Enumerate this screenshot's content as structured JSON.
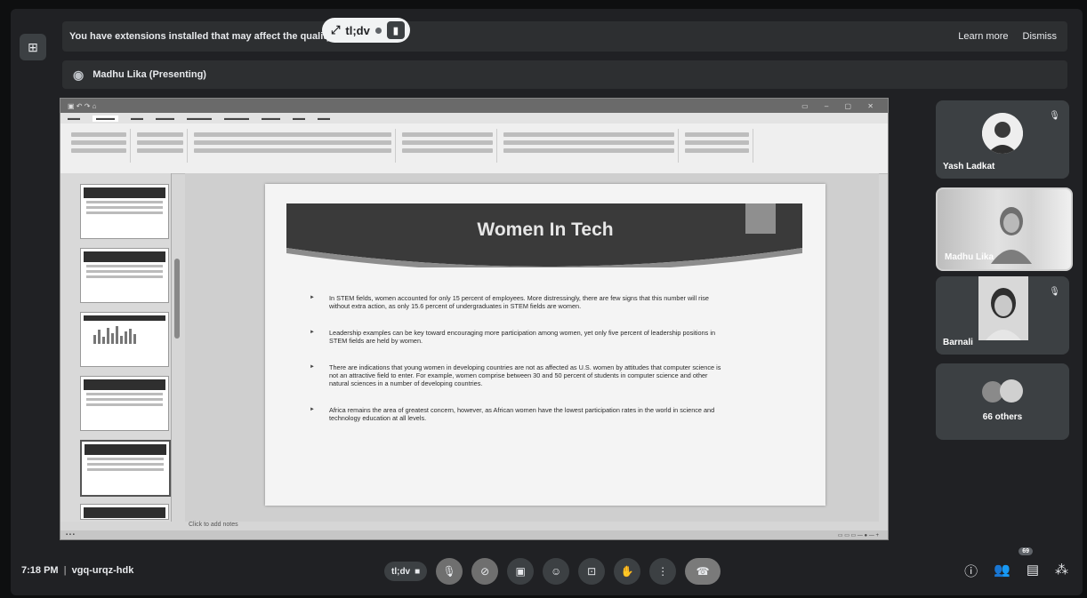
{
  "extensions_bar": {
    "message": "You have extensions installed that may affect the quality of your call",
    "learn_more": "Learn more",
    "dismiss": "Dismiss"
  },
  "tldv_chip": {
    "label": "tl;dv"
  },
  "presenter": {
    "label": "Madhu Lika (Presenting)"
  },
  "slide": {
    "title": "Women In Tech",
    "bullets": [
      "In STEM fields, women accounted for only 15 percent of employees. More distressingly, there are few signs that this number will rise without extra action, as only 15.6 percent of undergraduates in STEM fields are women.",
      "Leadership examples can be key toward encouraging more participation among women, yet only five percent of leadership positions in STEM fields are held by women.",
      "There are indications that young women in developing countries are not as affected as U.S. women by attitudes that computer science is not an attractive field to enter. For example, women comprise between 30 and 50 percent of students in computer science and other natural sciences in a number of developing countries.",
      "Africa remains the area of greatest concern, however, as African women have the lowest participation rates in the world in science and technology education at all levels."
    ],
    "notes_placeholder": "Click to add notes"
  },
  "participants": [
    {
      "name": "Yash Ladkat"
    },
    {
      "name": "Madhu Lika"
    },
    {
      "name": "Barnali"
    },
    {
      "name": "66 others"
    }
  ],
  "meeting": {
    "time": "7:18 PM",
    "separator": "|",
    "code": "vgq-urqz-hdk"
  },
  "controls": {
    "tldv_label": "tl;dv",
    "participant_count": "69"
  }
}
